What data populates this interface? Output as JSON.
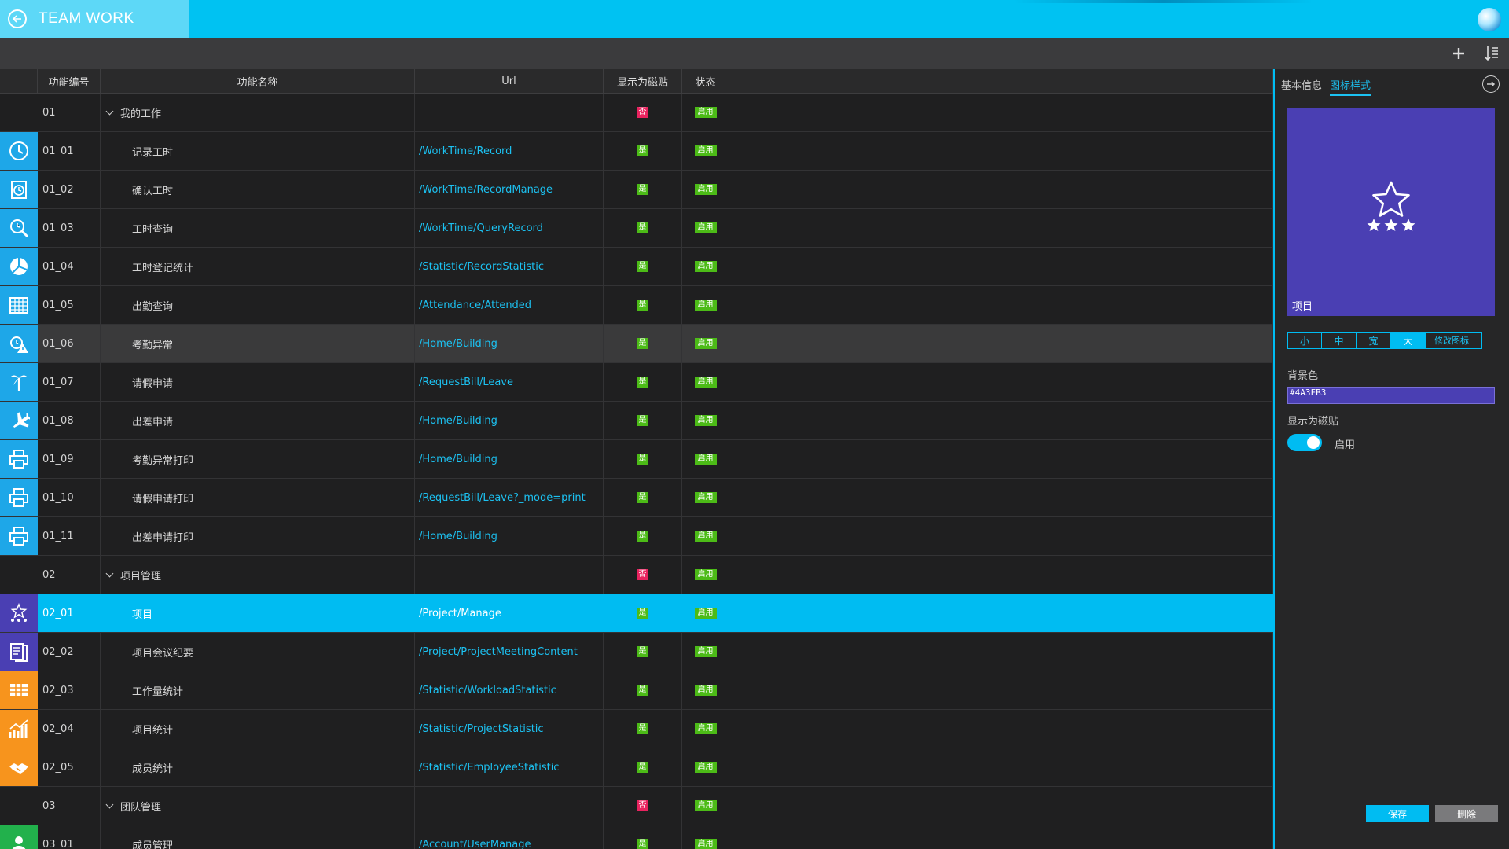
{
  "app": {
    "title": "TEAM WORK"
  },
  "grid": {
    "columns": {
      "code": "功能编号",
      "name": "功能名称",
      "url": "Url",
      "tile": "显示为磁贴",
      "status": "状态"
    },
    "rows": [
      {
        "code": "01",
        "name": "我的工作",
        "url": "",
        "tile": "否",
        "status": "启用",
        "group": true,
        "icon": "",
        "color": ""
      },
      {
        "code": "01_01",
        "name": "记录工时",
        "url": "/WorkTime/Record",
        "tile": "是",
        "status": "启用",
        "icon": "clock-icon",
        "color": "#1ea7e8"
      },
      {
        "code": "01_02",
        "name": "确认工时",
        "url": "/WorkTime/RecordManage",
        "tile": "是",
        "status": "启用",
        "icon": "clock-clipboard-icon",
        "color": "#1ea7e8"
      },
      {
        "code": "01_03",
        "name": "工时查询",
        "url": "/WorkTime/QueryRecord",
        "tile": "是",
        "status": "启用",
        "icon": "search-clock-icon",
        "color": "#1ea7e8"
      },
      {
        "code": "01_04",
        "name": "工时登记统计",
        "url": "/Statistic/RecordStatistic",
        "tile": "是",
        "status": "启用",
        "icon": "pie-chart-icon",
        "color": "#1ea7e8"
      },
      {
        "code": "01_05",
        "name": "出勤查询",
        "url": "/Attendance/Attended",
        "tile": "是",
        "status": "启用",
        "icon": "calendar-grid-icon",
        "color": "#1ea7e8"
      },
      {
        "code": "01_06",
        "name": "考勤异常",
        "url": "/Home/Building",
        "tile": "是",
        "status": "启用",
        "icon": "alarm-warning-icon",
        "color": "#1ea7e8",
        "hover": true
      },
      {
        "code": "01_07",
        "name": "请假申请",
        "url": "/RequestBill/Leave",
        "tile": "是",
        "status": "启用",
        "icon": "palm-tree-icon",
        "color": "#1ea7e8"
      },
      {
        "code": "01_08",
        "name": "出差申请",
        "url": "/Home/Building",
        "tile": "是",
        "status": "启用",
        "icon": "airplane-icon",
        "color": "#1ea7e8"
      },
      {
        "code": "01_09",
        "name": "考勤异常打印",
        "url": "/Home/Building",
        "tile": "是",
        "status": "启用",
        "icon": "printer-icon",
        "color": "#1ea7e8"
      },
      {
        "code": "01_10",
        "name": "请假申请打印",
        "url": "/RequestBill/Leave?_mode=print",
        "tile": "是",
        "status": "启用",
        "icon": "printer-icon",
        "color": "#1ea7e8"
      },
      {
        "code": "01_11",
        "name": "出差申请打印",
        "url": "/Home/Building",
        "tile": "是",
        "status": "启用",
        "icon": "printer-icon",
        "color": "#1ea7e8"
      },
      {
        "code": "02",
        "name": "项目管理",
        "url": "",
        "tile": "否",
        "status": "启用",
        "group": true,
        "icon": "",
        "color": ""
      },
      {
        "code": "02_01",
        "name": "项目",
        "url": "/Project/Manage",
        "tile": "是",
        "status": "启用",
        "icon": "stars-icon",
        "color": "#4a3fb3",
        "selected": true
      },
      {
        "code": "02_02",
        "name": "项目会议纪要",
        "url": "/Project/ProjectMeetingContent",
        "tile": "是",
        "status": "启用",
        "icon": "meeting-notes-icon",
        "color": "#4a3fb3"
      },
      {
        "code": "02_03",
        "name": "工作量统计",
        "url": "/Statistic/WorkloadStatistic",
        "tile": "是",
        "status": "启用",
        "icon": "table-icon",
        "color": "#f7941d"
      },
      {
        "code": "02_04",
        "name": "项目统计",
        "url": "/Statistic/ProjectStatistic",
        "tile": "是",
        "status": "启用",
        "icon": "trend-chart-icon",
        "color": "#f7941d"
      },
      {
        "code": "02_05",
        "name": "成员统计",
        "url": "/Statistic/EmployeeStatistic",
        "tile": "是",
        "status": "启用",
        "icon": "handshake-icon",
        "color": "#f7941d"
      },
      {
        "code": "03",
        "name": "团队管理",
        "url": "",
        "tile": "否",
        "status": "启用",
        "group": true,
        "icon": "",
        "color": ""
      },
      {
        "code": "03_01",
        "name": "成员管理",
        "url": "/Account/UserManage",
        "tile": "是",
        "status": "启用",
        "icon": "user-icon",
        "color": "#22b14c"
      }
    ]
  },
  "panel": {
    "tabs": [
      "基本信息",
      "图标样式"
    ],
    "active_tab": 1,
    "tile": {
      "label": "项目",
      "icon": "stars-icon",
      "background": "#4a3fb3"
    },
    "sizes": [
      "小",
      "中",
      "宽",
      "大"
    ],
    "active_size": 3,
    "edit_icon_label": "修改图标",
    "bg_color_label": "背景色",
    "bg_color_value": "#4A3FB3",
    "tile_toggle_label": "显示为磁贴",
    "tile_toggle_state": "启用",
    "save_label": "保存",
    "delete_label": "删除"
  }
}
